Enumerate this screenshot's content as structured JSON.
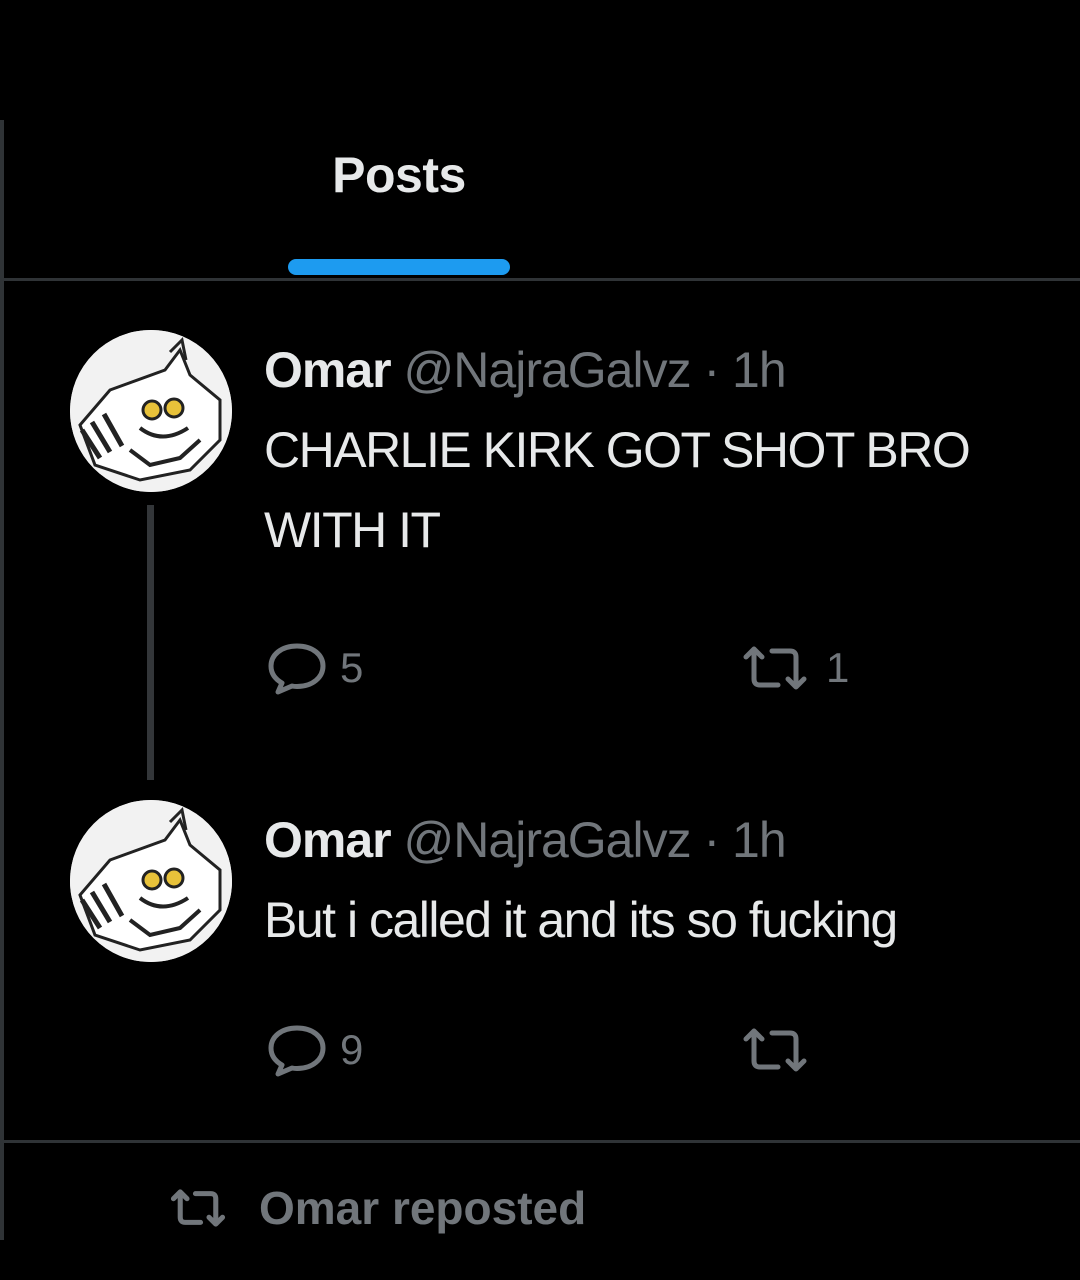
{
  "tabs": {
    "posts_label": "Posts"
  },
  "posts": [
    {
      "author": "Omar",
      "handle": "@NajraGalvz",
      "separator": "·",
      "time": "1h",
      "text_line1": "CHARLIE KIRK GOT SHOT BRO",
      "text_line2": "WITH IT",
      "reply_count": "5",
      "repost_count": "1"
    },
    {
      "author": "Omar",
      "handle": "@NajraGalvz",
      "separator": "·",
      "time": "1h",
      "text_line1": "But i called it and its so fucking",
      "reply_count": "9",
      "repost_count": ""
    }
  ],
  "repost_banner": {
    "text": "Omar reposted"
  },
  "colors": {
    "background": "#000000",
    "accent": "#1d9bf0",
    "primary_text": "#e7e9ea",
    "secondary_text": "#71767b",
    "divider": "#2f3336"
  },
  "icons": {
    "reply": "speech-bubble-icon",
    "repost": "repost-arrows-icon",
    "avatar": "cartoon-avatar"
  }
}
